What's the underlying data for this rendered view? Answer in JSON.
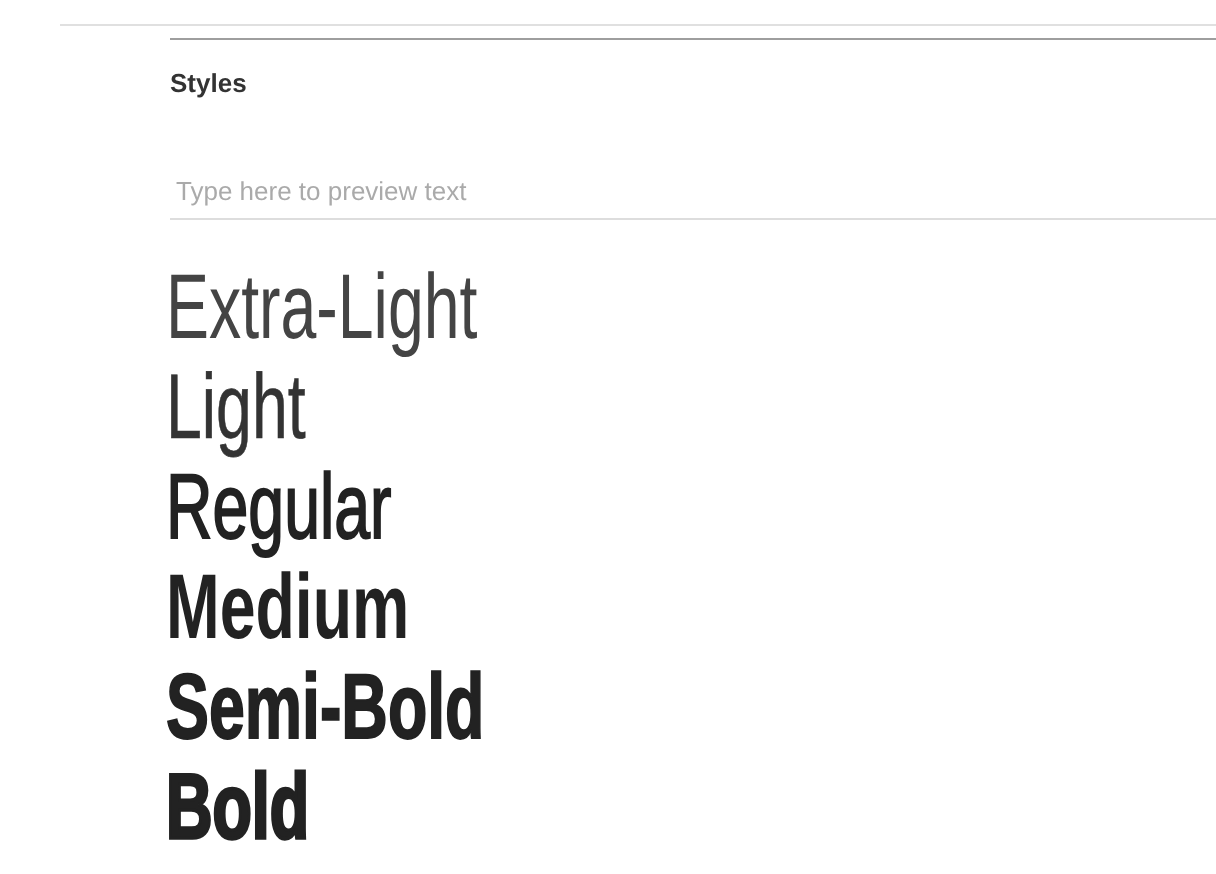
{
  "section": {
    "title": "Styles"
  },
  "preview": {
    "placeholder": "Type here to preview text"
  },
  "styles": [
    {
      "label": "Extra-Light",
      "kind": "extralight"
    },
    {
      "label": "Light",
      "kind": "light"
    },
    {
      "label": "Regular",
      "kind": "regular"
    },
    {
      "label": "Medium",
      "kind": "medium"
    },
    {
      "label": "Semi-Bold",
      "kind": "semibold"
    },
    {
      "label": "Bold",
      "kind": "bold"
    }
  ]
}
